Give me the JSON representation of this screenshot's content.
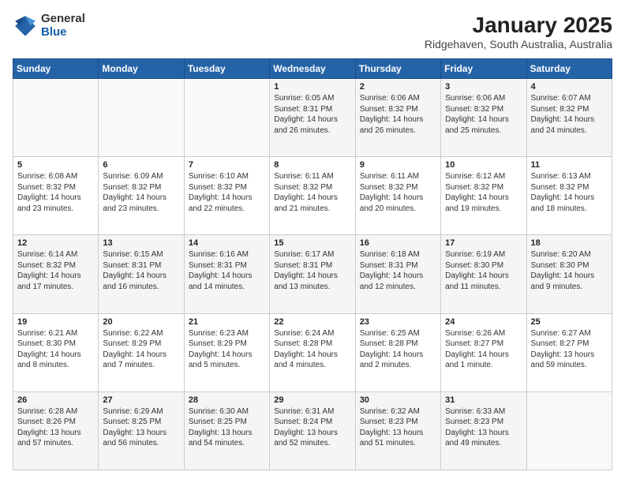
{
  "logo": {
    "general": "General",
    "blue": "Blue"
  },
  "title": "January 2025",
  "subtitle": "Ridgehaven, South Australia, Australia",
  "days_header": [
    "Sunday",
    "Monday",
    "Tuesday",
    "Wednesday",
    "Thursday",
    "Friday",
    "Saturday"
  ],
  "weeks": [
    [
      {
        "num": "",
        "info": ""
      },
      {
        "num": "",
        "info": ""
      },
      {
        "num": "",
        "info": ""
      },
      {
        "num": "1",
        "info": "Sunrise: 6:05 AM\nSunset: 8:31 PM\nDaylight: 14 hours\nand 26 minutes."
      },
      {
        "num": "2",
        "info": "Sunrise: 6:06 AM\nSunset: 8:32 PM\nDaylight: 14 hours\nand 26 minutes."
      },
      {
        "num": "3",
        "info": "Sunrise: 6:06 AM\nSunset: 8:32 PM\nDaylight: 14 hours\nand 25 minutes."
      },
      {
        "num": "4",
        "info": "Sunrise: 6:07 AM\nSunset: 8:32 PM\nDaylight: 14 hours\nand 24 minutes."
      }
    ],
    [
      {
        "num": "5",
        "info": "Sunrise: 6:08 AM\nSunset: 8:32 PM\nDaylight: 14 hours\nand 23 minutes."
      },
      {
        "num": "6",
        "info": "Sunrise: 6:09 AM\nSunset: 8:32 PM\nDaylight: 14 hours\nand 23 minutes."
      },
      {
        "num": "7",
        "info": "Sunrise: 6:10 AM\nSunset: 8:32 PM\nDaylight: 14 hours\nand 22 minutes."
      },
      {
        "num": "8",
        "info": "Sunrise: 6:11 AM\nSunset: 8:32 PM\nDaylight: 14 hours\nand 21 minutes."
      },
      {
        "num": "9",
        "info": "Sunrise: 6:11 AM\nSunset: 8:32 PM\nDaylight: 14 hours\nand 20 minutes."
      },
      {
        "num": "10",
        "info": "Sunrise: 6:12 AM\nSunset: 8:32 PM\nDaylight: 14 hours\nand 19 minutes."
      },
      {
        "num": "11",
        "info": "Sunrise: 6:13 AM\nSunset: 8:32 PM\nDaylight: 14 hours\nand 18 minutes."
      }
    ],
    [
      {
        "num": "12",
        "info": "Sunrise: 6:14 AM\nSunset: 8:32 PM\nDaylight: 14 hours\nand 17 minutes."
      },
      {
        "num": "13",
        "info": "Sunrise: 6:15 AM\nSunset: 8:31 PM\nDaylight: 14 hours\nand 16 minutes."
      },
      {
        "num": "14",
        "info": "Sunrise: 6:16 AM\nSunset: 8:31 PM\nDaylight: 14 hours\nand 14 minutes."
      },
      {
        "num": "15",
        "info": "Sunrise: 6:17 AM\nSunset: 8:31 PM\nDaylight: 14 hours\nand 13 minutes."
      },
      {
        "num": "16",
        "info": "Sunrise: 6:18 AM\nSunset: 8:31 PM\nDaylight: 14 hours\nand 12 minutes."
      },
      {
        "num": "17",
        "info": "Sunrise: 6:19 AM\nSunset: 8:30 PM\nDaylight: 14 hours\nand 11 minutes."
      },
      {
        "num": "18",
        "info": "Sunrise: 6:20 AM\nSunset: 8:30 PM\nDaylight: 14 hours\nand 9 minutes."
      }
    ],
    [
      {
        "num": "19",
        "info": "Sunrise: 6:21 AM\nSunset: 8:30 PM\nDaylight: 14 hours\nand 8 minutes."
      },
      {
        "num": "20",
        "info": "Sunrise: 6:22 AM\nSunset: 8:29 PM\nDaylight: 14 hours\nand 7 minutes."
      },
      {
        "num": "21",
        "info": "Sunrise: 6:23 AM\nSunset: 8:29 PM\nDaylight: 14 hours\nand 5 minutes."
      },
      {
        "num": "22",
        "info": "Sunrise: 6:24 AM\nSunset: 8:28 PM\nDaylight: 14 hours\nand 4 minutes."
      },
      {
        "num": "23",
        "info": "Sunrise: 6:25 AM\nSunset: 8:28 PM\nDaylight: 14 hours\nand 2 minutes."
      },
      {
        "num": "24",
        "info": "Sunrise: 6:26 AM\nSunset: 8:27 PM\nDaylight: 14 hours\nand 1 minute."
      },
      {
        "num": "25",
        "info": "Sunrise: 6:27 AM\nSunset: 8:27 PM\nDaylight: 13 hours\nand 59 minutes."
      }
    ],
    [
      {
        "num": "26",
        "info": "Sunrise: 6:28 AM\nSunset: 8:26 PM\nDaylight: 13 hours\nand 57 minutes."
      },
      {
        "num": "27",
        "info": "Sunrise: 6:29 AM\nSunset: 8:25 PM\nDaylight: 13 hours\nand 56 minutes."
      },
      {
        "num": "28",
        "info": "Sunrise: 6:30 AM\nSunset: 8:25 PM\nDaylight: 13 hours\nand 54 minutes."
      },
      {
        "num": "29",
        "info": "Sunrise: 6:31 AM\nSunset: 8:24 PM\nDaylight: 13 hours\nand 52 minutes."
      },
      {
        "num": "30",
        "info": "Sunrise: 6:32 AM\nSunset: 8:23 PM\nDaylight: 13 hours\nand 51 minutes."
      },
      {
        "num": "31",
        "info": "Sunrise: 6:33 AM\nSunset: 8:23 PM\nDaylight: 13 hours\nand 49 minutes."
      },
      {
        "num": "",
        "info": ""
      }
    ]
  ]
}
